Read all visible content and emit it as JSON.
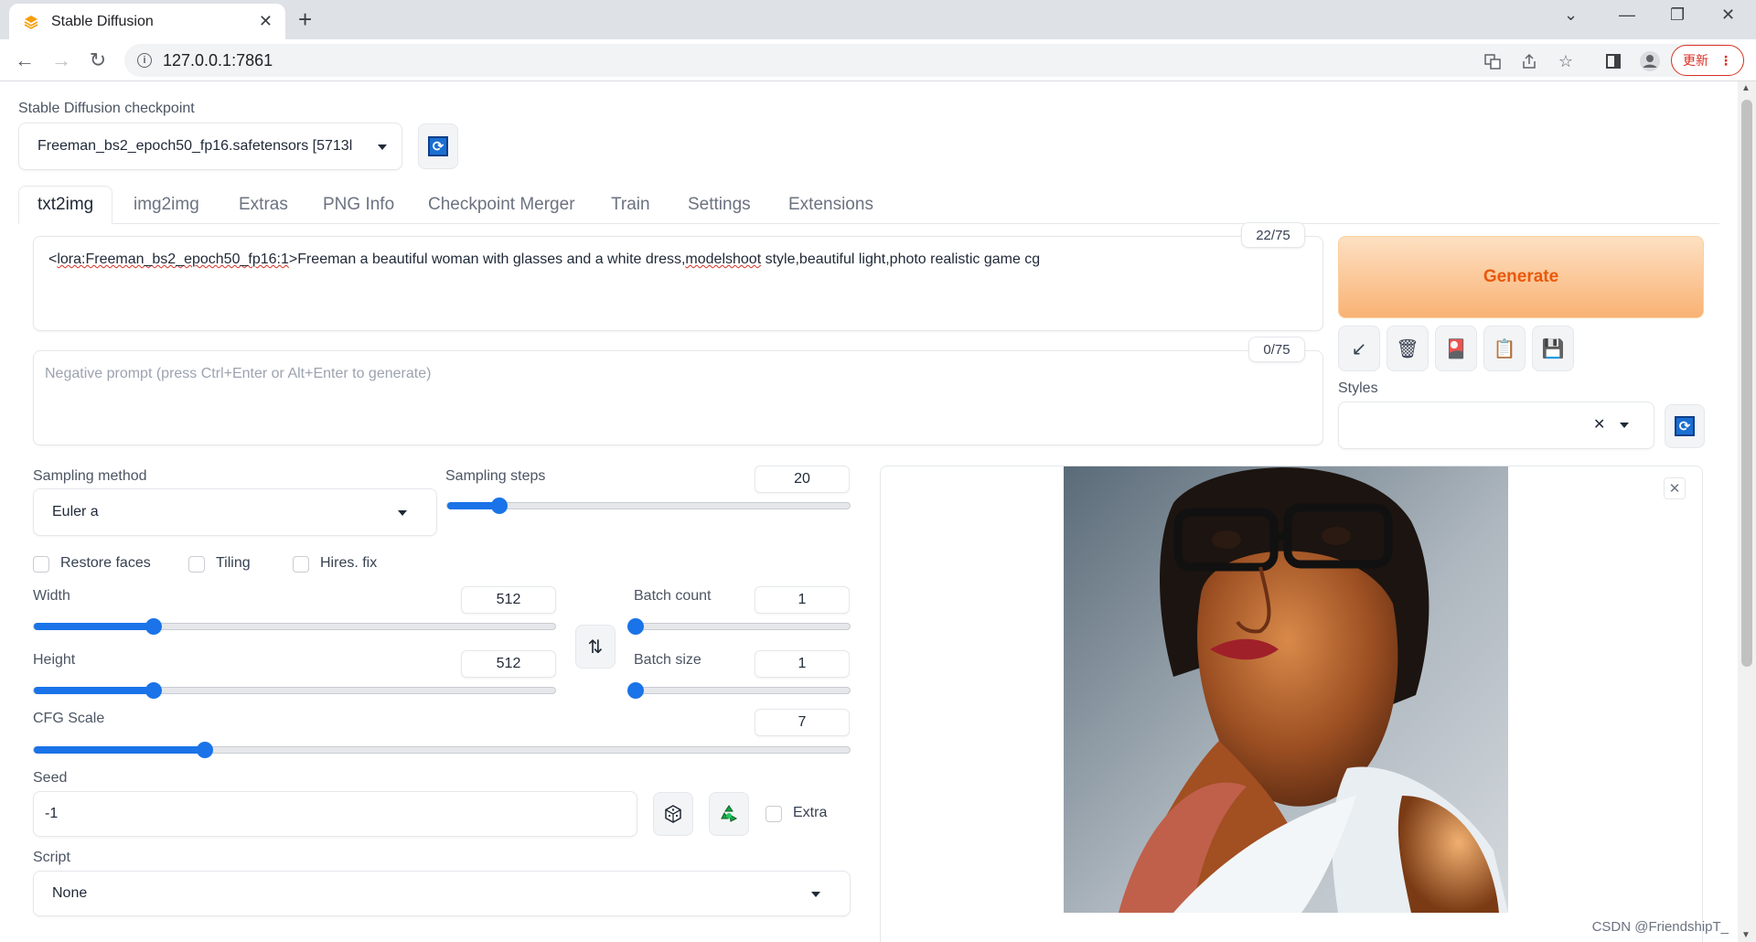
{
  "browser": {
    "tab_title": "Stable Diffusion",
    "new_tab": "+",
    "tab_close": "✕",
    "url": "127.0.0.1:7861",
    "update_label": "更新",
    "update_menu": "⋮",
    "win_minimize": "—",
    "win_restore": "❐",
    "win_close": "✕",
    "tab_dropdown": "⌄"
  },
  "checkpoint": {
    "label": "Stable Diffusion checkpoint",
    "value": "Freeman_bs2_epoch50_fp16.safetensors [5713l"
  },
  "tabs": [
    "txt2img",
    "img2img",
    "Extras",
    "PNG Info",
    "Checkpoint Merger",
    "Train",
    "Settings",
    "Extensions"
  ],
  "prompt": {
    "lt": "<",
    "lora": "lora:Freeman_bs2_epoch50_fp16:1",
    "mid": ">Freeman a beautiful woman with glasses and a white dress,",
    "modelshoot": "modelshoot",
    "rest": " style,beautiful light,photo realistic game cg",
    "counter": "22/75"
  },
  "negative_prompt": {
    "placeholder": "Negative prompt (press Ctrl+Enter or Alt+Enter to generate)",
    "counter": "0/75"
  },
  "generate_label": "Generate",
  "tool_buttons": [
    "↙",
    "🗑",
    "🎴",
    "📋",
    "💾"
  ],
  "styles": {
    "label": "Styles",
    "clear": "✕"
  },
  "sampling": {
    "method_label": "Sampling method",
    "method_value": "Euler a",
    "steps_label": "Sampling steps",
    "steps_value": "20",
    "steps_fraction": 0.13
  },
  "checkboxes": {
    "restore_faces": "Restore faces",
    "tiling": "Tiling",
    "hires_fix": "Hires. fix",
    "extra": "Extra"
  },
  "width": {
    "label": "Width",
    "value": "512",
    "fraction": 0.23
  },
  "height": {
    "label": "Height",
    "value": "512",
    "fraction": 0.23
  },
  "swap_icon": "⇅",
  "batch_count": {
    "label": "Batch count",
    "value": "1",
    "fraction": 0.0
  },
  "batch_size": {
    "label": "Batch size",
    "value": "1",
    "fraction": 0.0
  },
  "cfg": {
    "label": "CFG Scale",
    "value": "7",
    "fraction": 0.21
  },
  "seed": {
    "label": "Seed",
    "value": "-1"
  },
  "script": {
    "label": "Script",
    "value": "None"
  },
  "watermark": "CSDN @FriendshipT_",
  "colors": {
    "accent": "#1a73e8",
    "generate": "#ea580c"
  }
}
